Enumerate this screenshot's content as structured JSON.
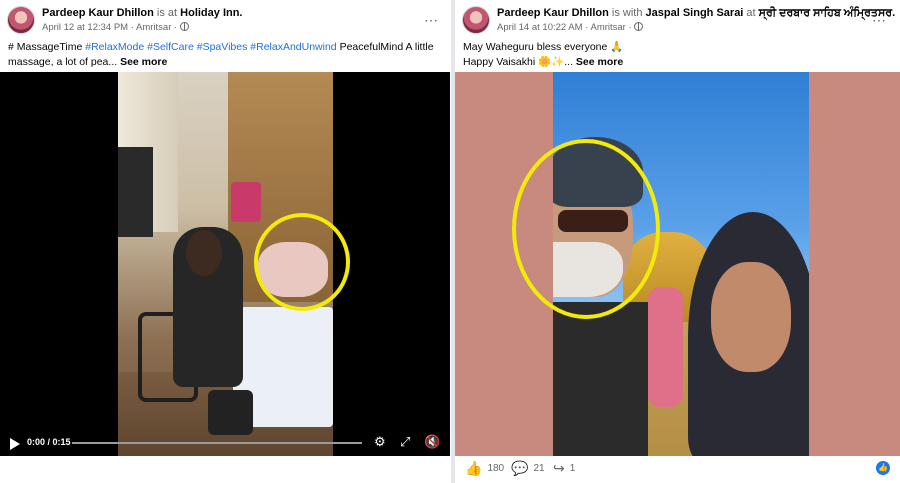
{
  "left_post": {
    "author": "Pardeep Kaur Dhillon",
    "connector": " is at ",
    "place": "Holiday Inn.",
    "date": "April 12 at 12:34 PM",
    "location": "Amritsar",
    "caption": {
      "lead": "# MassageTime ",
      "hashtags": [
        "#RelaxMode",
        "#SelfCare",
        "#SpaVibes",
        "#RelaxAndUnwind"
      ],
      "rest": " PeacefulMind A little massage, a lot of pea...",
      "see_more": "See more"
    },
    "video": {
      "time": "0:00 / 0:15",
      "progress": 0
    }
  },
  "right_post": {
    "author": "Pardeep Kaur Dhillon",
    "connector": " is with ",
    "with_person": "Jaspal Singh Sarai",
    "at_word": " at ",
    "place": "ਸ੍ਰੀ ਦਰਬਾਰ ਸਾਹਿਬ ਅੰਮ੍ਰਿਤਸਰ.",
    "date": "April 14 at 10:22 AM",
    "location": "Amritsar",
    "caption_line1": "May Waheguru bless everyone 🙏",
    "caption_line2": "Happy Vaisakhi 🌼✨...",
    "see_more": "See more",
    "likes": "180",
    "comments": "21",
    "shares": "1"
  },
  "icons": {
    "more": "⋯",
    "gear": "⚙",
    "fullscreen": "⤢",
    "mute": "🔇",
    "like": "👍",
    "comment": "💬",
    "share": "↪",
    "reaction_badge": "👍"
  },
  "colors": {
    "highlight": "#f2ea0b",
    "hashtag": "#216fdb",
    "photo_background": "#c88a7e"
  }
}
